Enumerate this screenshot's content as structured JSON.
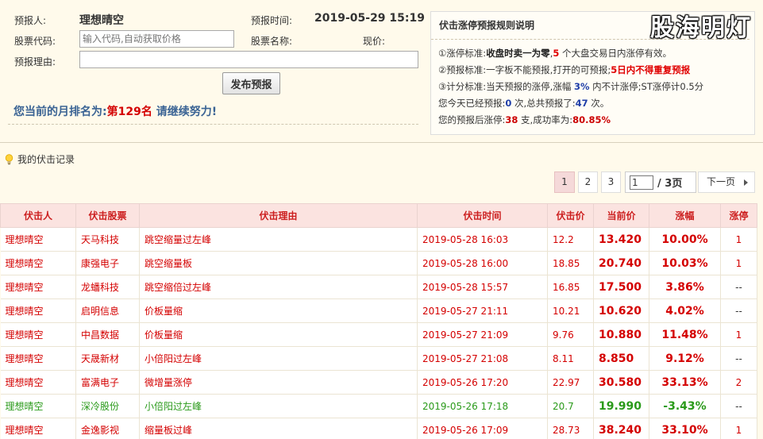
{
  "watermark": "股海明灯",
  "form": {
    "forecaster_label": "预报人:",
    "forecaster_name": "理想晴空",
    "time_label": "预报时间:",
    "time_value": "2019-05-29 15:19",
    "code_label": "股票代码:",
    "code_placeholder": "输入代码,自动获取价格",
    "name_label": "股票名称:",
    "price_label": "现价:",
    "reason_label": "预报理由:",
    "reason_value": "",
    "submit_label": "发布预报",
    "rank_prefix": "您当前的月排名为:",
    "rank_value": "第129名",
    "rank_suffix": " 请继续努力!"
  },
  "rules": {
    "title": "伏击涨停预报规则说明",
    "l1_prefix": "①涨停标准:",
    "l1_strong": "收盘时卖一为零",
    "l1_sep": ",",
    "l1_num": "5",
    "l1_suffix": " 个大盘交易日内涨停有效。",
    "l2_prefix": "②预报标准:一字板不能预报,打开的可预报;",
    "l2_red": "5日内不得重复预报",
    "l3_prefix": "③计分标准:当天预报的涨停,涨幅 ",
    "l3_blue": "3%",
    "l3_suffix": " 内不计涨停;ST涨停计0.5分",
    "l4_prefix": "您今天已经预报:",
    "l4_today": "0",
    "l4_mid": " 次,总共预报了:",
    "l4_total": "47",
    "l4_suffix": " 次。",
    "l5_prefix": "您的预报后涨停:",
    "l5_hits": "38",
    "l5_mid": " 支,成功率为:",
    "l5_rate": "80.85%"
  },
  "records": {
    "heading": "我的伏击记录",
    "pages": [
      "1",
      "2",
      "3"
    ],
    "current_page_input": "1",
    "total_pages": "/ 3页",
    "next_label": "下一页",
    "columns": [
      "伏击人",
      "伏击股票",
      "伏击理由",
      "伏击时间",
      "伏击价",
      "当前价",
      "涨幅",
      "涨停"
    ],
    "rows": [
      {
        "user": "理想晴空",
        "stock": "天马科技",
        "reason": "跳空缩量过左峰",
        "time": "2019-05-28 16:03",
        "price": "12.2",
        "current": "13.420",
        "change": "10.00%",
        "limit": "1",
        "trend": "up"
      },
      {
        "user": "理想晴空",
        "stock": "康强电子",
        "reason": "跳空缩量板",
        "time": "2019-05-28 16:00",
        "price": "18.85",
        "current": "20.740",
        "change": "10.03%",
        "limit": "1",
        "trend": "up"
      },
      {
        "user": "理想晴空",
        "stock": "龙蟠科技",
        "reason": "跳空缩倍过左峰",
        "time": "2019-05-28 15:57",
        "price": "16.85",
        "current": "17.500",
        "change": "3.86%",
        "limit": "--",
        "trend": "up"
      },
      {
        "user": "理想晴空",
        "stock": "启明信息",
        "reason": "价板量缩",
        "time": "2019-05-27 21:11",
        "price": "10.21",
        "current": "10.620",
        "change": "4.02%",
        "limit": "--",
        "trend": "up"
      },
      {
        "user": "理想晴空",
        "stock": "中昌数据",
        "reason": "价板量缩",
        "time": "2019-05-27 21:09",
        "price": "9.76",
        "current": "10.880",
        "change": "11.48%",
        "limit": "1",
        "trend": "up"
      },
      {
        "user": "理想晴空",
        "stock": "天晟新材",
        "reason": "小倍阳过左峰",
        "time": "2019-05-27 21:08",
        "price": "8.11",
        "current": "8.850",
        "change": "9.12%",
        "limit": "--",
        "trend": "up"
      },
      {
        "user": "理想晴空",
        "stock": "富满电子",
        "reason": "微增量涨停",
        "time": "2019-05-26 17:20",
        "price": "22.97",
        "current": "30.580",
        "change": "33.13%",
        "limit": "2",
        "trend": "up"
      },
      {
        "user": "理想晴空",
        "stock": "深冷股份",
        "reason": "小倍阳过左峰",
        "time": "2019-05-26 17:18",
        "price": "20.7",
        "current": "19.990",
        "change": "-3.43%",
        "limit": "--",
        "trend": "down"
      },
      {
        "user": "理想晴空",
        "stock": "金逸影视",
        "reason": "缩量板过峰",
        "time": "2019-05-26 17:09",
        "price": "28.73",
        "current": "38.240",
        "change": "33.10%",
        "limit": "1",
        "trend": "up"
      }
    ]
  }
}
